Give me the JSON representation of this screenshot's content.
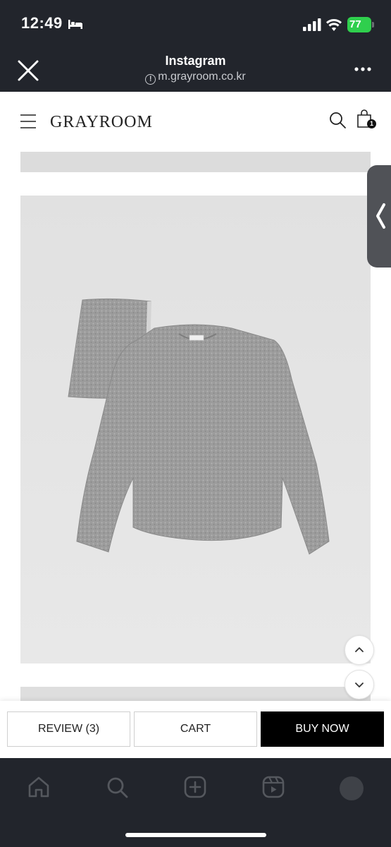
{
  "status_bar": {
    "time": "12:49",
    "battery": "77",
    "icons": [
      "bed-icon",
      "signal-icon",
      "wifi-icon",
      "battery-icon"
    ]
  },
  "browser": {
    "title": "Instagram",
    "url": "m.grayroom.co.kr",
    "icons": [
      "close-icon",
      "info-icon",
      "more-icon"
    ]
  },
  "site": {
    "logo": "GRAYROOM",
    "cart_count": "1",
    "icons": [
      "menu-icon",
      "search-icon",
      "shopping-bag-icon",
      "chevron-left-icon",
      "chevron-up-icon",
      "chevron-down-icon"
    ]
  },
  "actions": {
    "review": "REVIEW (3)",
    "cart": "CART",
    "buy_now": "BUY NOW"
  },
  "bottom_nav": {
    "icons": [
      "home-icon",
      "search-icon",
      "create-icon",
      "reels-icon",
      "profile-avatar"
    ]
  },
  "colors": {
    "chrome": "#22252c",
    "battery": "#2fcf4d",
    "buy_now": "#000000",
    "product_bg": "#e3e3e3",
    "knit": "#9a9a9a"
  }
}
